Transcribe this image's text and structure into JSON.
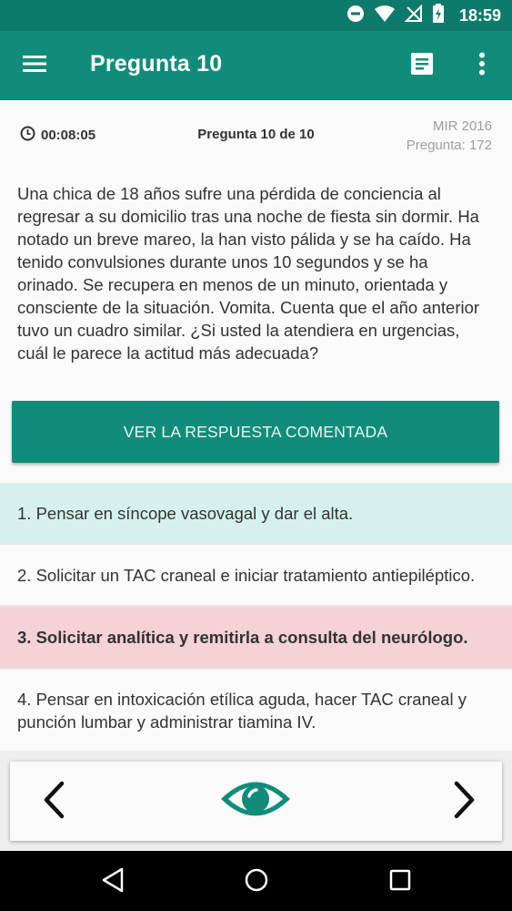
{
  "status_bar": {
    "time": "18:59",
    "icons": [
      "do-not-disturb-icon",
      "wifi-icon",
      "no-signal-icon",
      "battery-charging-icon"
    ]
  },
  "app_bar": {
    "title": "Pregunta 10",
    "icons": [
      "menu-icon",
      "notes-icon",
      "more-vert-icon"
    ]
  },
  "meta": {
    "timer": "00:08:05",
    "question_counter": "Pregunta 10 de 10",
    "exam": "MIR 2016",
    "exam_question": "Pregunta: 172"
  },
  "question": {
    "text": "Una chica de 18 años sufre una pérdida de conciencia al regresar a su domicilio tras una noche de fiesta sin dormir. Ha notado un breve mareo, la han visto pálida y se ha caído. Ha tenido convulsiones durante unos 10 segundos y se ha orinado. Se recupera en menos de un minuto, orientada y consciente de la situación. Vomita. Cuenta que el año anterior tuvo un cuadro similar. ¿Si usted la atendiera en urgencias, cuál le parece la actitud más adecuada?"
  },
  "answer_button": {
    "label": "VER LA RESPUESTA COMENTADA"
  },
  "options": [
    {
      "text": "1. Pensar en síncope vasovagal y dar el alta.",
      "state": "correct"
    },
    {
      "text": "2. Solicitar un TAC craneal e iniciar tratamiento antiepiléptico.",
      "state": "neutral"
    },
    {
      "text": "3. Solicitar analítica y remitirla a consulta del neurólogo.",
      "state": "wrong"
    },
    {
      "text": "4. Pensar en intoxicación etílica aguda, hacer TAC craneal y punción lumbar y administrar tiamina IV.",
      "state": "neutral"
    }
  ],
  "bottom_nav": {
    "icons": [
      "chevron-left-icon",
      "eye-icon",
      "chevron-right-icon"
    ]
  },
  "system_nav": {
    "icons": [
      "back-icon",
      "home-icon",
      "recents-icon"
    ]
  },
  "colors": {
    "primary": "#128c7a",
    "primary_dark": "#0e7a6b",
    "correct_bg": "#d6f1ed",
    "wrong_bg": "#f4d2d6"
  }
}
